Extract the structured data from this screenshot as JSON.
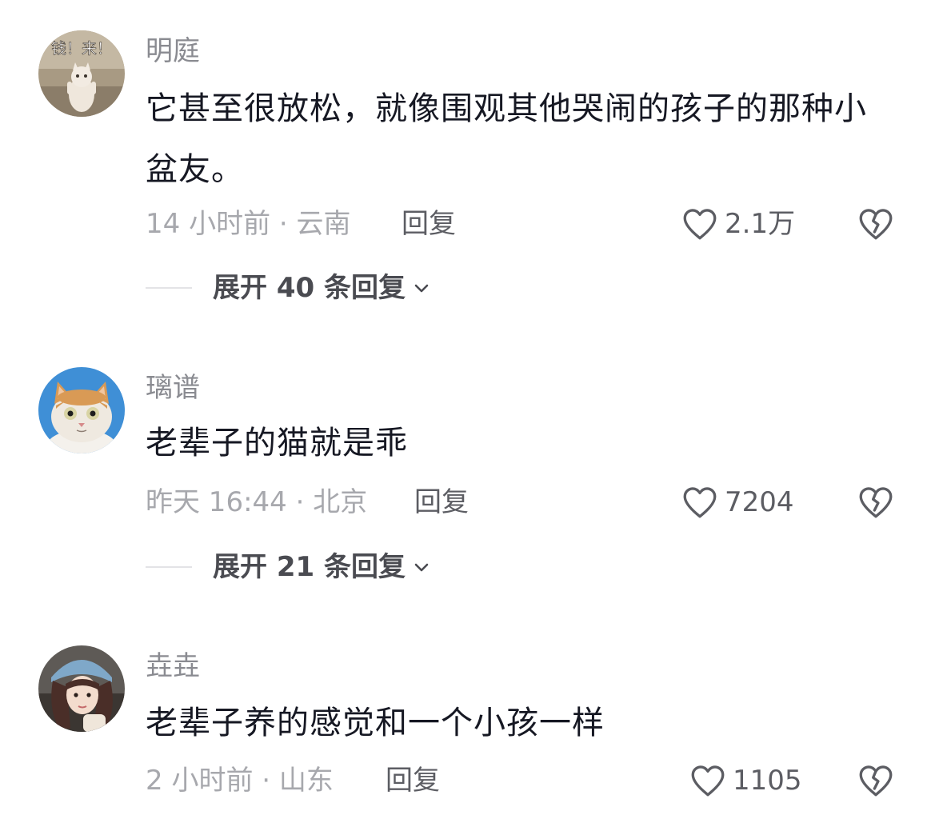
{
  "comments": [
    {
      "username": "明庭",
      "avatar_caption": "钱！来！",
      "text": "它甚至很放松，就像围观其他哭闹的孩子的那种小盆友。",
      "time_location": "14 小时前 · 云南",
      "reply_label": "回复",
      "like_count": "2.1万",
      "expand_label": "展开 40 条回复"
    },
    {
      "username": "璃谱",
      "text": "老辈子的猫就是乖",
      "time_location": "昨天 16:44 · 北京",
      "reply_label": "回复",
      "like_count": "7204",
      "expand_label": "展开 21 条回复"
    },
    {
      "username": "垚垚",
      "text": "老辈子养的感觉和一个小孩一样",
      "time_location": "2 小时前 · 山东",
      "reply_label": "回复",
      "like_count": "1105"
    }
  ],
  "icons": {
    "like": "heart-outline-icon",
    "dislike": "broken-heart-icon",
    "expand": "chevron-down-icon"
  },
  "colors": {
    "primary_text": "#161823",
    "secondary_text": "#8a8b91",
    "meta_text": "#a7a8ad",
    "icon": "#5c5d63"
  }
}
